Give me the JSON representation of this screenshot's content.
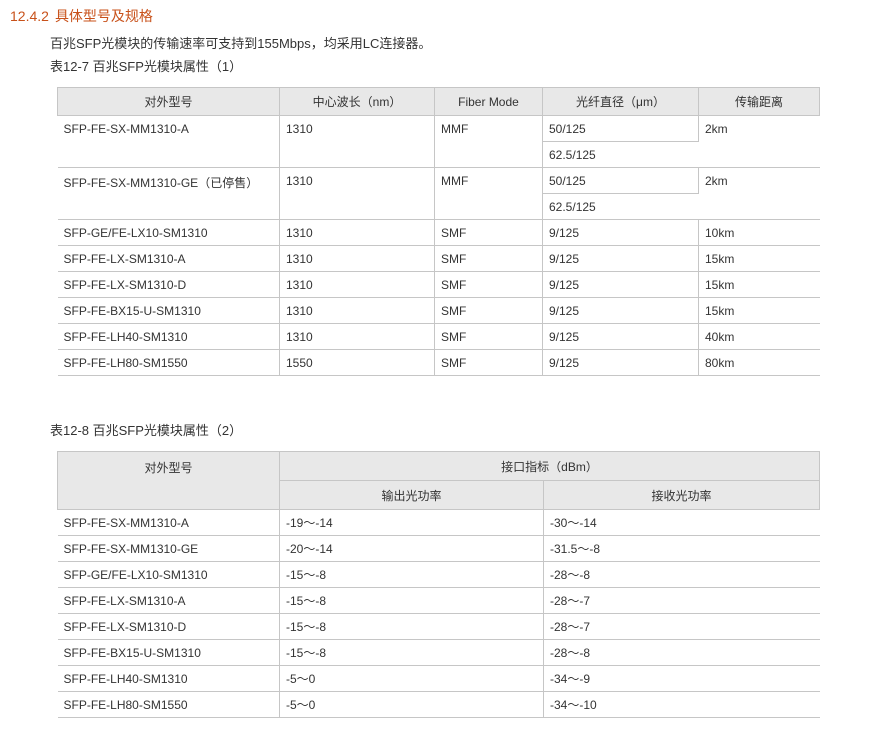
{
  "section": {
    "number": "12.4.2",
    "title": "具体型号及规格",
    "intro": "百兆SFP光模块的传输速率可支持到155Mbps，均采用LC连接器。"
  },
  "table1": {
    "caption": "表12-7 百兆SFP光模块属性（1）",
    "headers": [
      "对外型号",
      "中心波长（nm）",
      "Fiber Mode",
      "光纤直径（μm）",
      "传输距离"
    ],
    "rows": [
      {
        "model": "SFP-FE-SX-MM1310-A",
        "wavelength": "1310",
        "mode": "MMF",
        "diameters": [
          "50/125",
          "62.5/125"
        ],
        "distance": "2km"
      },
      {
        "model": "SFP-FE-SX-MM1310-GE（已停售）",
        "wavelength": "1310",
        "mode": "MMF",
        "diameters": [
          "50/125",
          "62.5/125"
        ],
        "distance": "2km"
      },
      {
        "model": "SFP-GE/FE-LX10-SM1310",
        "wavelength": "1310",
        "mode": "SMF",
        "diameters": [
          "9/125"
        ],
        "distance": "10km"
      },
      {
        "model": "SFP-FE-LX-SM1310-A",
        "wavelength": "1310",
        "mode": "SMF",
        "diameters": [
          "9/125"
        ],
        "distance": "15km"
      },
      {
        "model": "SFP-FE-LX-SM1310-D",
        "wavelength": "1310",
        "mode": "SMF",
        "diameters": [
          "9/125"
        ],
        "distance": "15km"
      },
      {
        "model": "SFP-FE-BX15-U-SM1310",
        "wavelength": "1310",
        "mode": "SMF",
        "diameters": [
          "9/125"
        ],
        "distance": "15km"
      },
      {
        "model": "SFP-FE-LH40-SM1310",
        "wavelength": "1310",
        "mode": "SMF",
        "diameters": [
          "9/125"
        ],
        "distance": "40km"
      },
      {
        "model": "SFP-FE-LH80-SM1550",
        "wavelength": "1550",
        "mode": "SMF",
        "diameters": [
          "9/125"
        ],
        "distance": "80km"
      }
    ]
  },
  "table2": {
    "caption": "表12-8 百兆SFP光模块属性（2）",
    "header_model": "对外型号",
    "header_group": "接口指标（dBm）",
    "header_tx": "输出光功率",
    "header_rx": "接收光功率",
    "rows": [
      {
        "model": "SFP-FE-SX-MM1310-A",
        "tx": "-19～-14",
        "rx": "-30～-14"
      },
      {
        "model": "SFP-FE-SX-MM1310-GE",
        "tx": "-20～-14",
        "rx": "-31.5～-8"
      },
      {
        "model": "SFP-GE/FE-LX10-SM1310",
        "tx": "-15～-8",
        "rx": "-28～-8"
      },
      {
        "model": "SFP-FE-LX-SM1310-A",
        "tx": "-15～-8",
        "rx": "-28～-7"
      },
      {
        "model": "SFP-FE-LX-SM1310-D",
        "tx": "-15～-8",
        "rx": "-28～-7"
      },
      {
        "model": "SFP-FE-BX15-U-SM1310",
        "tx": "-15～-8",
        "rx": "-28～-8"
      },
      {
        "model": "SFP-FE-LH40-SM1310",
        "tx": "-5～0",
        "rx": "-34～-9"
      },
      {
        "model": "SFP-FE-LH80-SM1550",
        "tx": "-5～0",
        "rx": "-34～-10"
      }
    ]
  },
  "colors": {
    "heading": "#c8511a",
    "header_bg": "#e8e8e8",
    "border": "#c6c6c6",
    "rule": "#222222"
  }
}
